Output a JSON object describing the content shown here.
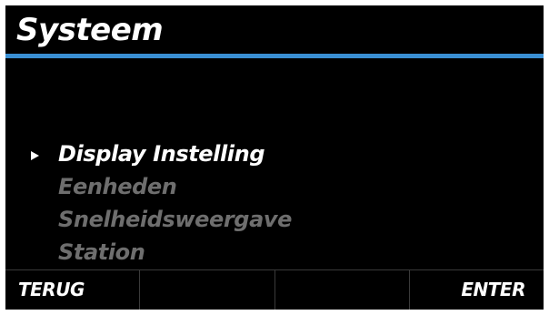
{
  "screen": {
    "title": "Systeem",
    "accent_color": "#3a8fd3",
    "background_color": "#000000"
  },
  "menu": {
    "selected_index": 0,
    "pointer_icon": "triangle-right-icon",
    "items": [
      {
        "label": "Display Instelling",
        "state": "selected"
      },
      {
        "label": "Eenheden",
        "state": "unselected"
      },
      {
        "label": "Snelheidsweergave",
        "state": "unselected"
      },
      {
        "label": "Station",
        "state": "unselected"
      }
    ]
  },
  "softkeys": {
    "key1": "TERUG",
    "key2": "",
    "key3": "",
    "key4": "ENTER"
  }
}
